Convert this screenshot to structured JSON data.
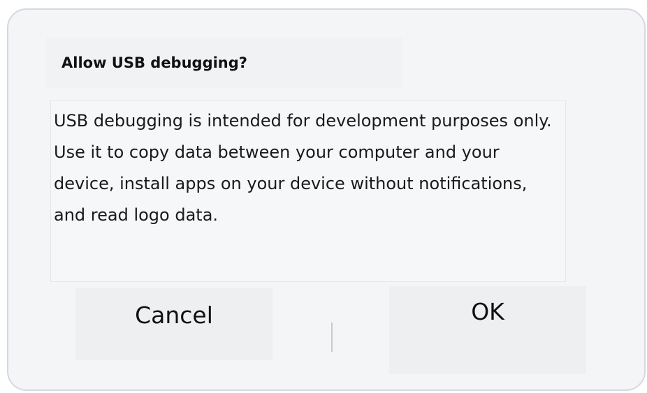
{
  "dialog": {
    "title": "Allow USB debugging?",
    "message": "USB debugging is intended for development purposes only. Use it to copy data between your computer and your device, install apps on your device without notifications, and read logo data.",
    "cancel_label": "Cancel",
    "ok_label": "OK"
  },
  "colors": {
    "dialog_background": "#f4f5f7",
    "button_background": "#eeeff1",
    "text": "#111111"
  }
}
